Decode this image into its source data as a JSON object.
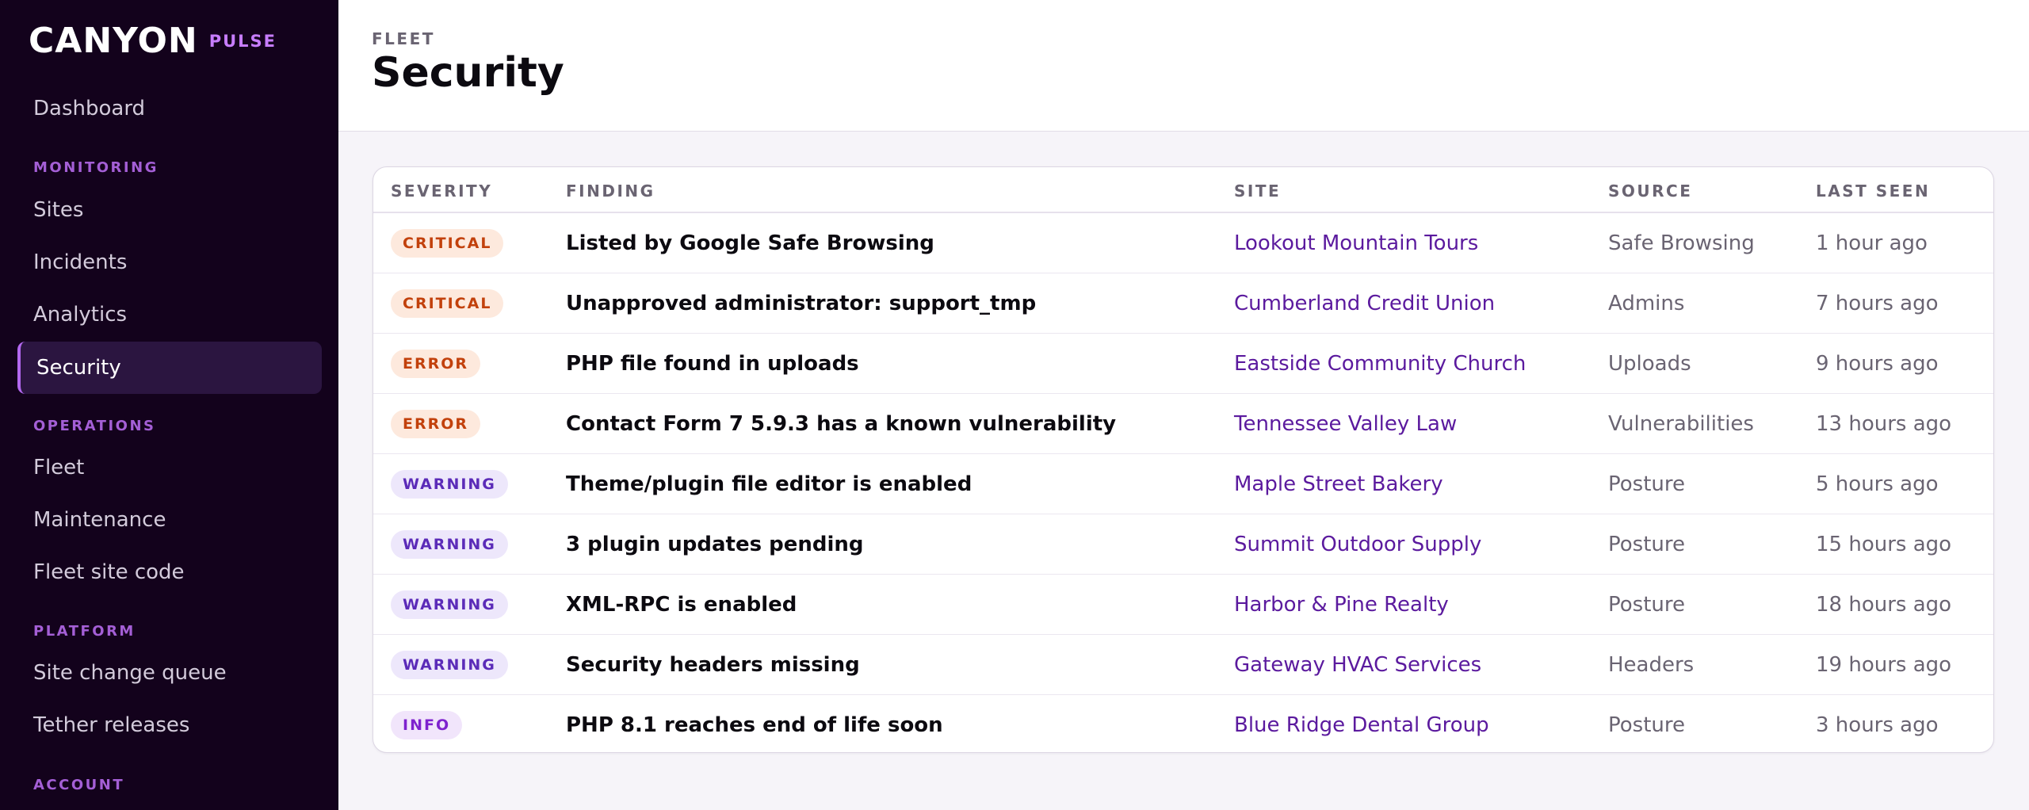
{
  "brand": {
    "logo": "CANYON",
    "product": "PULSE"
  },
  "sidebar": {
    "items": [
      {
        "label": "Dashboard"
      },
      {
        "section": "MONITORING"
      },
      {
        "label": "Sites"
      },
      {
        "label": "Incidents"
      },
      {
        "label": "Analytics"
      },
      {
        "label": "Security",
        "active": true
      },
      {
        "section": "OPERATIONS"
      },
      {
        "label": "Fleet"
      },
      {
        "label": "Maintenance"
      },
      {
        "label": "Fleet site code"
      },
      {
        "section": "PLATFORM"
      },
      {
        "label": "Site change queue"
      },
      {
        "label": "Tether releases"
      },
      {
        "section": "ACCOUNT"
      }
    ]
  },
  "header": {
    "eyebrow": "FLEET",
    "title": "Security"
  },
  "table": {
    "columns": [
      "SEVERITY",
      "FINDING",
      "SITE",
      "SOURCE",
      "LAST SEEN"
    ],
    "rows": [
      {
        "severity": "CRITICAL",
        "finding": "Listed by Google Safe Browsing",
        "site": "Lookout Mountain Tours",
        "source": "Safe Browsing",
        "last_seen": "1 hour ago"
      },
      {
        "severity": "CRITICAL",
        "finding": "Unapproved administrator: support_tmp",
        "site": "Cumberland Credit Union",
        "source": "Admins",
        "last_seen": "7 hours ago"
      },
      {
        "severity": "ERROR",
        "finding": "PHP file found in uploads",
        "site": "Eastside Community Church",
        "source": "Uploads",
        "last_seen": "9 hours ago"
      },
      {
        "severity": "ERROR",
        "finding": "Contact Form 7 5.9.3 has a known vulnerability",
        "site": "Tennessee Valley Law",
        "source": "Vulnerabilities",
        "last_seen": "13 hours ago"
      },
      {
        "severity": "WARNING",
        "finding": "Theme/plugin file editor is enabled",
        "site": "Maple Street Bakery",
        "source": "Posture",
        "last_seen": "5 hours ago"
      },
      {
        "severity": "WARNING",
        "finding": "3 plugin updates pending",
        "site": "Summit Outdoor Supply",
        "source": "Posture",
        "last_seen": "15 hours ago"
      },
      {
        "severity": "WARNING",
        "finding": "XML-RPC is enabled",
        "site": "Harbor & Pine Realty",
        "source": "Posture",
        "last_seen": "18 hours ago"
      },
      {
        "severity": "WARNING",
        "finding": "Security headers missing",
        "site": "Gateway HVAC Services",
        "source": "Headers",
        "last_seen": "19 hours ago"
      },
      {
        "severity": "INFO",
        "finding": "PHP 8.1 reaches end of life soon",
        "site": "Blue Ridge Dental Group",
        "source": "Posture",
        "last_seen": "3 hours ago"
      }
    ]
  },
  "colors": {
    "sidebar_bg": "#13021c",
    "accent": "#c77dff",
    "site_link": "#5b1a9e",
    "critical": "#c2410c",
    "warning": "#5b2bb8",
    "info": "#7e22ce"
  }
}
